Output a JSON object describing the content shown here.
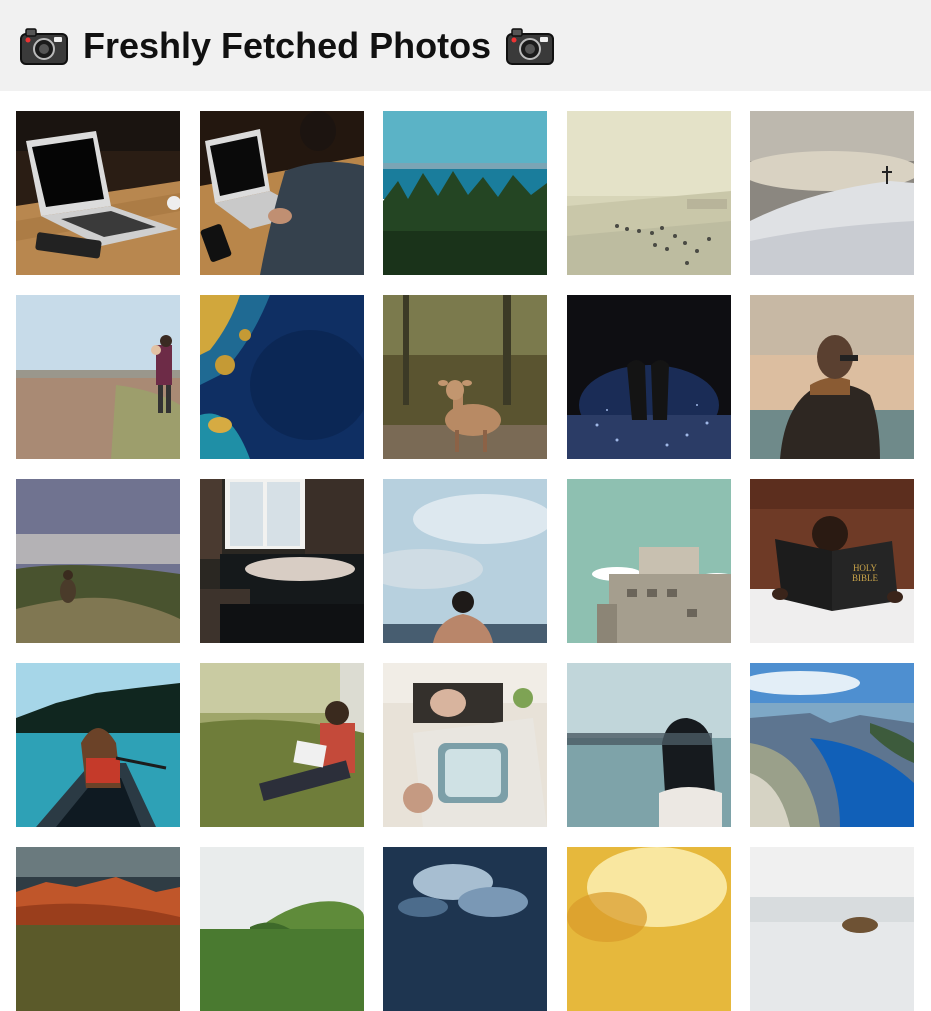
{
  "header": {
    "title": "Freshly Fetched Photos",
    "leading_icon": "camera-with-flash-icon",
    "trailing_icon": "camera-with-flash-icon"
  },
  "photos": [
    {
      "subject": "laptop-on-wooden-desk"
    },
    {
      "subject": "person-typing-on-laptop"
    },
    {
      "subject": "forest-and-sea"
    },
    {
      "subject": "beach-crowd"
    },
    {
      "subject": "snowy-hill-with-cross"
    },
    {
      "subject": "man-carrying-child-on-beach"
    },
    {
      "subject": "aerial-ocean-coast"
    },
    {
      "subject": "deer-in-forest"
    },
    {
      "subject": "couple-at-night"
    },
    {
      "subject": "person-facing-sea"
    },
    {
      "subject": "person-on-misty-cliff"
    },
    {
      "subject": "person-sleeping-on-sofa"
    },
    {
      "subject": "man-looking-at-sky"
    },
    {
      "subject": "old-stone-bunker"
    },
    {
      "subject": "child-reading-bible"
    },
    {
      "subject": "woman-in-canoe"
    },
    {
      "subject": "person-reading-in-grass"
    },
    {
      "subject": "person-in-vintage-van"
    },
    {
      "subject": "blindfolded-woman-by-sea"
    },
    {
      "subject": "fjord-landscape"
    },
    {
      "subject": "sunlit-cliffs"
    },
    {
      "subject": "green-hills-in-fog"
    },
    {
      "subject": "dramatic-clouds"
    },
    {
      "subject": "golden-haze"
    },
    {
      "subject": "snowy-field-animal"
    }
  ]
}
